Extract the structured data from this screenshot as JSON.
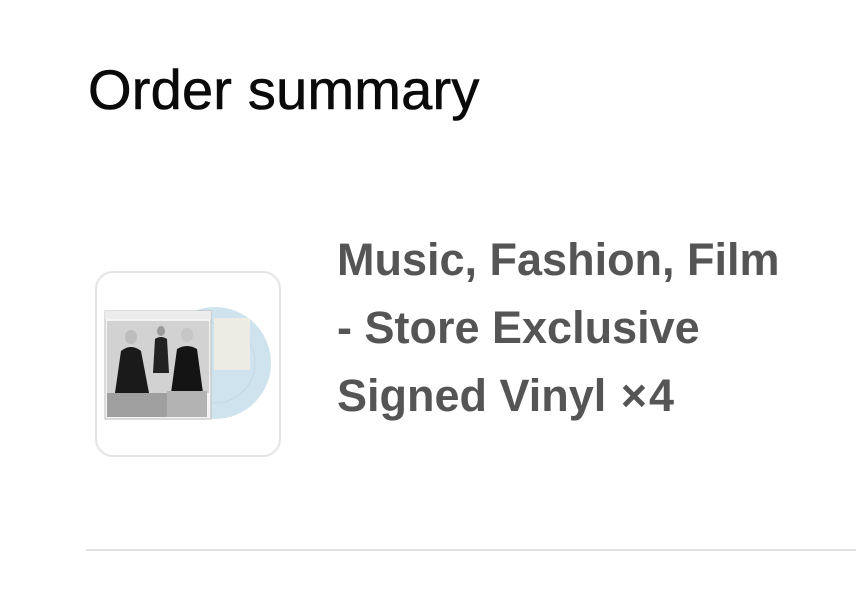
{
  "order_summary": {
    "title": "Order summary",
    "items": [
      {
        "name": "Music, Fashion, Film - Store Exclusive Signed Vinyl",
        "quantity_symbol": "×",
        "quantity": "4",
        "image": "vinyl-record-thumbnail",
        "vinyl_color": "#cfe3ee"
      }
    ]
  }
}
